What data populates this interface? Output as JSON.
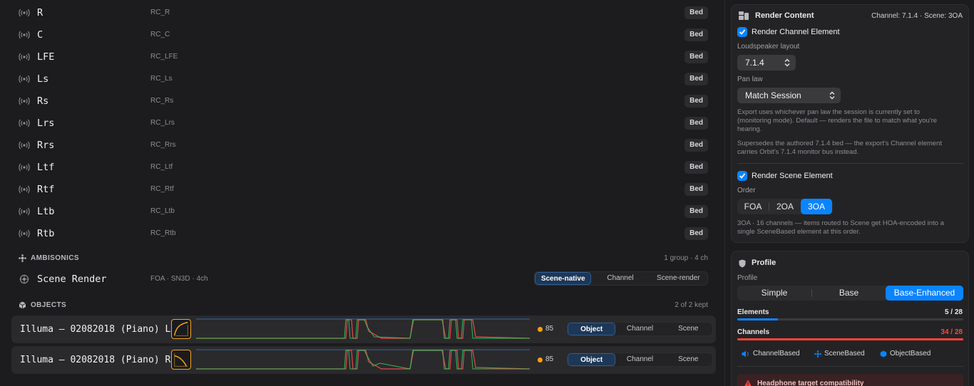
{
  "channels": [
    {
      "name": "R",
      "id": "RC_R",
      "badge": "Bed"
    },
    {
      "name": "C",
      "id": "RC_C",
      "badge": "Bed"
    },
    {
      "name": "LFE",
      "id": "RC_LFE",
      "badge": "Bed"
    },
    {
      "name": "Ls",
      "id": "RC_Ls",
      "badge": "Bed"
    },
    {
      "name": "Rs",
      "id": "RC_Rs",
      "badge": "Bed"
    },
    {
      "name": "Lrs",
      "id": "RC_Lrs",
      "badge": "Bed"
    },
    {
      "name": "Rrs",
      "id": "RC_Rrs",
      "badge": "Bed"
    },
    {
      "name": "Ltf",
      "id": "RC_Ltf",
      "badge": "Bed"
    },
    {
      "name": "Rtf",
      "id": "RC_Rtf",
      "badge": "Bed"
    },
    {
      "name": "Ltb",
      "id": "RC_Ltb",
      "badge": "Bed"
    },
    {
      "name": "Rtb",
      "id": "RC_Rtb",
      "badge": "Bed"
    }
  ],
  "ambisonics": {
    "label": "AMBISONICS",
    "count": "1 group · 4 ch",
    "row": {
      "name": "Scene Render",
      "format": "FOA · SN3D · 4ch",
      "modes": [
        "Scene-native",
        "Channel",
        "Scene-render"
      ],
      "active_mode": "Scene-native"
    }
  },
  "objects": {
    "label": "OBJECTS",
    "count": "2 of 2 kept",
    "rows": [
      {
        "name": "Illuma – 02082018 (Piano) L",
        "value": "85",
        "modes": [
          "Object",
          "Channel",
          "Scene"
        ],
        "active_mode": "Object"
      },
      {
        "name": "Illuma – 02082018 (Piano) R",
        "value": "85",
        "modes": [
          "Object",
          "Channel",
          "Scene"
        ],
        "active_mode": "Object"
      }
    ]
  },
  "render_content": {
    "title": "Render Content",
    "summary": "Channel: 7.1.4 · Scene: 3OA",
    "channel_element": {
      "label": "Render Channel Element",
      "checked": true,
      "layout_label": "Loudspeaker layout",
      "layout_value": "7.1.4",
      "pan_label": "Pan law",
      "pan_value": "Match Session",
      "help1_line1": "Export uses whichever pan law the session is currently set to",
      "help1_line2": "(monitoring mode). Default — renders the file to match what you're",
      "help1_line3": "hearing.",
      "help2_line1": "Supersedes the authored 7.1.4 bed — the export's Channel element",
      "help2_line2": "carries Orbit's 7.1.4 monitor bus instead."
    },
    "scene_element": {
      "label": "Render Scene Element",
      "checked": true,
      "order_label": "Order",
      "orders": [
        "FOA",
        "2OA",
        "3OA"
      ],
      "active_order": "3OA",
      "help_line1": "3OA · 16 channels — items routed to Scene get HOA-encoded into a",
      "help_line2": "single SceneBased element at this order."
    }
  },
  "profile": {
    "title": "Profile",
    "label": "Profile",
    "options": [
      "Simple",
      "Base",
      "Base-Enhanced"
    ],
    "active": "Base-Enhanced",
    "elements_label": "Elements",
    "elements_value": "5 / 28",
    "elements_fraction": 0.18,
    "channels_label": "Channels",
    "channels_value": "34 / 28",
    "channels_fraction": 1.0,
    "types": [
      "ChannelBased",
      "SceneBased",
      "ObjectBased"
    ],
    "warning": "Headphone target compatibility"
  },
  "colors": {
    "accent": "#0a84ff",
    "over_limit": "#ff453a",
    "object_orange": "#ff9f0a"
  }
}
